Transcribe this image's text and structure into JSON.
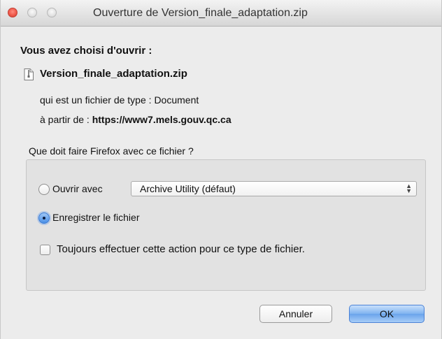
{
  "window": {
    "title": "Ouverture de Version_finale_adaptation.zip",
    "traffic_lights": [
      "close-button",
      "minimize-button",
      "maximize-button"
    ]
  },
  "content": {
    "heading": "Vous avez choisi d'ouvrir :",
    "file_icon": "document-icon",
    "file_name": "Version_finale_adaptation.zip",
    "type_prefix": "qui est un fichier de type :",
    "type_value": "Document",
    "from_prefix": "à partir de :",
    "from_value": "https://www7.mels.gouv.qc.ca"
  },
  "action": {
    "question": "Que doit faire Firefox avec ce fichier ?",
    "open_label": "Ouvrir avec",
    "open_selected": false,
    "app_select_value": "Archive Utility (défaut)",
    "save_label": "Enregistrer le fichier",
    "save_selected": true,
    "always_label": "Toujours effectuer cette action pour ce type de fichier.",
    "always_checked": false
  },
  "buttons": {
    "cancel": "Annuler",
    "ok": "OK"
  },
  "colors": {
    "close_light": "#f05a4c",
    "accent": "#4a8fe6"
  }
}
